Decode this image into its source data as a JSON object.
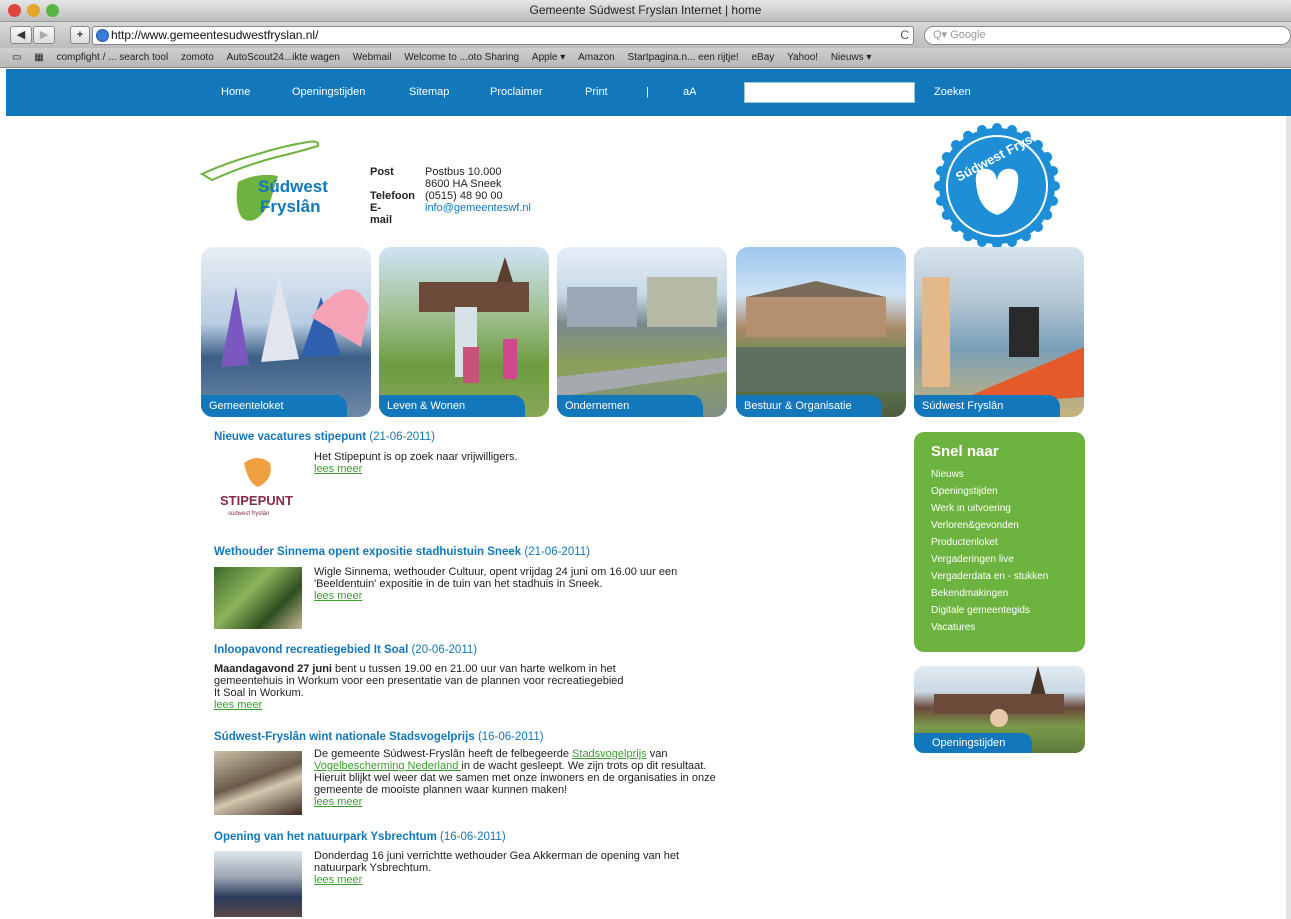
{
  "browser": {
    "title": "Gemeente Súdwest Fryslan Internet | home",
    "url": "http://www.gemeentesudwestfryslan.nl/",
    "search_placeholder": "Google",
    "bookmarks": [
      "compfight / ... search tool",
      "zomoto",
      "AutoScout24...ikte wagen",
      "Webmail",
      "Welcome to ...oto Sharing",
      "Apple ▾",
      "Amazon",
      "Startpagina.n... een rijtje!",
      "eBay",
      "Yahoo!",
      "Nieuws ▾"
    ]
  },
  "nav": {
    "items": [
      "Home",
      "Openingstijden",
      "Sitemap",
      "Proclaimer",
      "Print",
      "|",
      "aA"
    ],
    "search_button": "Zoeken"
  },
  "header": {
    "logo_text": [
      "Súdwest",
      "Fryslân"
    ],
    "contact": {
      "post_label": "Post",
      "post_lines": [
        "Postbus 10.000",
        "8600 HA  Sneek"
      ],
      "phone_label": "Telefoon",
      "phone": "(0515) 48 90 00",
      "email_label": "E-mail",
      "email": "info@gemeenteswf.nl"
    },
    "seal_text": "Súdwest Fryslân"
  },
  "tiles": [
    "Gemeenteloket",
    "Leven & Wonen",
    "Ondernemen",
    "Bestuur & Organisatie",
    "Súdwest Fryslân"
  ],
  "news": [
    {
      "title": "Nieuwe vacatures stipepunt",
      "date": "(21-06-2011)",
      "text": "Het Stipepunt is op zoek naar vrijwilligers.",
      "more": "lees meer",
      "thumb_text": [
        "STIPEPUNT",
        "súdwest fryslân"
      ]
    },
    {
      "title": "Wethouder Sinnema opent expositie stadhuistuin Sneek",
      "date": "(21-06-2011)",
      "text": "Wigle Sinnema, wethouder Cultuur,  opent vrijdag 24 juni om 16.00 uur een 'Beeldentuin' expositie in de tuin van het stadhuis in Sneek.",
      "more": "lees meer"
    },
    {
      "title": "Inloopavond recreatiegebied It Soal",
      "date": "(20-06-2011)",
      "bold": "Maandagavond 27 juni",
      "text": " bent u tussen 19.00 en 21.00 uur van harte welkom in het gemeentehuis in Workum voor een presentatie van de plannen voor recreatiegebied It Soal in Workum.",
      "more": "lees meer"
    },
    {
      "title": "Súdwest-Fryslân wint nationale Stadsvogelprijs",
      "date": "(16-06-2011)",
      "text_a": "De gemeente Súdwest-Fryslân heeft de felbegeerde ",
      "link_a": "Stadsvogelprijs",
      "text_b": " van ",
      "link_b": "Vogelbescherming Nederland ",
      "text_c": "in de wacht gesleept. We zijn trots op dit resultaat. Hieruit blijkt wel weer dat we samen met onze inwoners en de organisaties in onze gemeente de mooiste plannen waar kunnen maken!",
      "more": "lees meer"
    },
    {
      "title": "Opening van het natuurpark Ysbrechtum",
      "date": "(16-06-2011)",
      "text": "Donderdag 16 juni verrichtte wethouder Gea Akkerman de opening van het natuurpark Ysbrechtum.",
      "more": "lees meer"
    }
  ],
  "snel_naar": {
    "title": "Snel naar",
    "links": [
      "Nieuws",
      "Openingstijden",
      "Werk in uitvoering",
      "Verloren&gevonden",
      "Productenloket",
      "Vergaderingen live",
      "Vergaderdata en - stukken",
      "Bekendmakingen",
      "Digitale gemeentegids",
      "Vacatures"
    ]
  },
  "openingstijden_tile": "Openingstijden",
  "colors": {
    "primary": "#1277bb",
    "green": "#6db33f"
  }
}
